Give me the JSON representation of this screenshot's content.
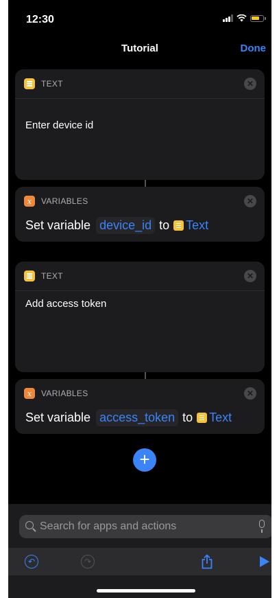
{
  "status": {
    "time": "12:30"
  },
  "nav": {
    "title": "Tutorial",
    "done_label": "Done"
  },
  "actions": [
    {
      "category": "TEXT",
      "text": "Enter device id"
    },
    {
      "category": "VARIABLES",
      "set_label": "Set variable",
      "variable_name": "device_id",
      "to_label": "to",
      "value_token": "Text"
    },
    {
      "category": "TEXT",
      "text": "Add access token"
    },
    {
      "category": "VARIABLES",
      "set_label": "Set variable",
      "variable_name": "access_token",
      "to_label": "to",
      "value_token": "Text"
    }
  ],
  "add_button": {
    "icon": "plus-icon",
    "label": "+"
  },
  "search": {
    "placeholder": "Search for apps and actions"
  },
  "toolbar": {
    "undo_icon": "undo-icon",
    "redo_icon": "redo-icon",
    "share_icon": "share-icon",
    "play_icon": "play-icon"
  },
  "colors": {
    "accent": "#3a84f7",
    "text_app": "#f5c33b",
    "variables_app": "#f0883a",
    "card_bg": "#1c1c1e"
  }
}
